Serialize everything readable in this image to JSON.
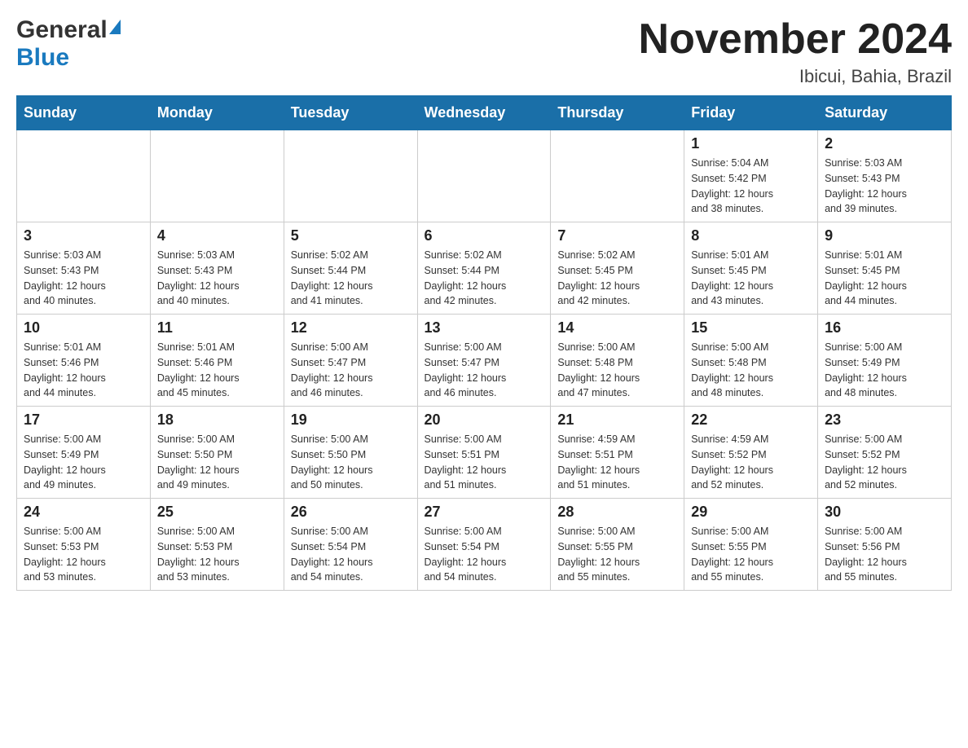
{
  "header": {
    "logo_general": "General",
    "logo_blue": "Blue",
    "month_title": "November 2024",
    "location": "Ibicui, Bahia, Brazil"
  },
  "days_of_week": [
    "Sunday",
    "Monday",
    "Tuesday",
    "Wednesday",
    "Thursday",
    "Friday",
    "Saturday"
  ],
  "weeks": [
    {
      "days": [
        {
          "number": "",
          "info": ""
        },
        {
          "number": "",
          "info": ""
        },
        {
          "number": "",
          "info": ""
        },
        {
          "number": "",
          "info": ""
        },
        {
          "number": "",
          "info": ""
        },
        {
          "number": "1",
          "info": "Sunrise: 5:04 AM\nSunset: 5:42 PM\nDaylight: 12 hours\nand 38 minutes."
        },
        {
          "number": "2",
          "info": "Sunrise: 5:03 AM\nSunset: 5:43 PM\nDaylight: 12 hours\nand 39 minutes."
        }
      ]
    },
    {
      "days": [
        {
          "number": "3",
          "info": "Sunrise: 5:03 AM\nSunset: 5:43 PM\nDaylight: 12 hours\nand 40 minutes."
        },
        {
          "number": "4",
          "info": "Sunrise: 5:03 AM\nSunset: 5:43 PM\nDaylight: 12 hours\nand 40 minutes."
        },
        {
          "number": "5",
          "info": "Sunrise: 5:02 AM\nSunset: 5:44 PM\nDaylight: 12 hours\nand 41 minutes."
        },
        {
          "number": "6",
          "info": "Sunrise: 5:02 AM\nSunset: 5:44 PM\nDaylight: 12 hours\nand 42 minutes."
        },
        {
          "number": "7",
          "info": "Sunrise: 5:02 AM\nSunset: 5:45 PM\nDaylight: 12 hours\nand 42 minutes."
        },
        {
          "number": "8",
          "info": "Sunrise: 5:01 AM\nSunset: 5:45 PM\nDaylight: 12 hours\nand 43 minutes."
        },
        {
          "number": "9",
          "info": "Sunrise: 5:01 AM\nSunset: 5:45 PM\nDaylight: 12 hours\nand 44 minutes."
        }
      ]
    },
    {
      "days": [
        {
          "number": "10",
          "info": "Sunrise: 5:01 AM\nSunset: 5:46 PM\nDaylight: 12 hours\nand 44 minutes."
        },
        {
          "number": "11",
          "info": "Sunrise: 5:01 AM\nSunset: 5:46 PM\nDaylight: 12 hours\nand 45 minutes."
        },
        {
          "number": "12",
          "info": "Sunrise: 5:00 AM\nSunset: 5:47 PM\nDaylight: 12 hours\nand 46 minutes."
        },
        {
          "number": "13",
          "info": "Sunrise: 5:00 AM\nSunset: 5:47 PM\nDaylight: 12 hours\nand 46 minutes."
        },
        {
          "number": "14",
          "info": "Sunrise: 5:00 AM\nSunset: 5:48 PM\nDaylight: 12 hours\nand 47 minutes."
        },
        {
          "number": "15",
          "info": "Sunrise: 5:00 AM\nSunset: 5:48 PM\nDaylight: 12 hours\nand 48 minutes."
        },
        {
          "number": "16",
          "info": "Sunrise: 5:00 AM\nSunset: 5:49 PM\nDaylight: 12 hours\nand 48 minutes."
        }
      ]
    },
    {
      "days": [
        {
          "number": "17",
          "info": "Sunrise: 5:00 AM\nSunset: 5:49 PM\nDaylight: 12 hours\nand 49 minutes."
        },
        {
          "number": "18",
          "info": "Sunrise: 5:00 AM\nSunset: 5:50 PM\nDaylight: 12 hours\nand 49 minutes."
        },
        {
          "number": "19",
          "info": "Sunrise: 5:00 AM\nSunset: 5:50 PM\nDaylight: 12 hours\nand 50 minutes."
        },
        {
          "number": "20",
          "info": "Sunrise: 5:00 AM\nSunset: 5:51 PM\nDaylight: 12 hours\nand 51 minutes."
        },
        {
          "number": "21",
          "info": "Sunrise: 4:59 AM\nSunset: 5:51 PM\nDaylight: 12 hours\nand 51 minutes."
        },
        {
          "number": "22",
          "info": "Sunrise: 4:59 AM\nSunset: 5:52 PM\nDaylight: 12 hours\nand 52 minutes."
        },
        {
          "number": "23",
          "info": "Sunrise: 5:00 AM\nSunset: 5:52 PM\nDaylight: 12 hours\nand 52 minutes."
        }
      ]
    },
    {
      "days": [
        {
          "number": "24",
          "info": "Sunrise: 5:00 AM\nSunset: 5:53 PM\nDaylight: 12 hours\nand 53 minutes."
        },
        {
          "number": "25",
          "info": "Sunrise: 5:00 AM\nSunset: 5:53 PM\nDaylight: 12 hours\nand 53 minutes."
        },
        {
          "number": "26",
          "info": "Sunrise: 5:00 AM\nSunset: 5:54 PM\nDaylight: 12 hours\nand 54 minutes."
        },
        {
          "number": "27",
          "info": "Sunrise: 5:00 AM\nSunset: 5:54 PM\nDaylight: 12 hours\nand 54 minutes."
        },
        {
          "number": "28",
          "info": "Sunrise: 5:00 AM\nSunset: 5:55 PM\nDaylight: 12 hours\nand 55 minutes."
        },
        {
          "number": "29",
          "info": "Sunrise: 5:00 AM\nSunset: 5:55 PM\nDaylight: 12 hours\nand 55 minutes."
        },
        {
          "number": "30",
          "info": "Sunrise: 5:00 AM\nSunset: 5:56 PM\nDaylight: 12 hours\nand 55 minutes."
        }
      ]
    }
  ]
}
